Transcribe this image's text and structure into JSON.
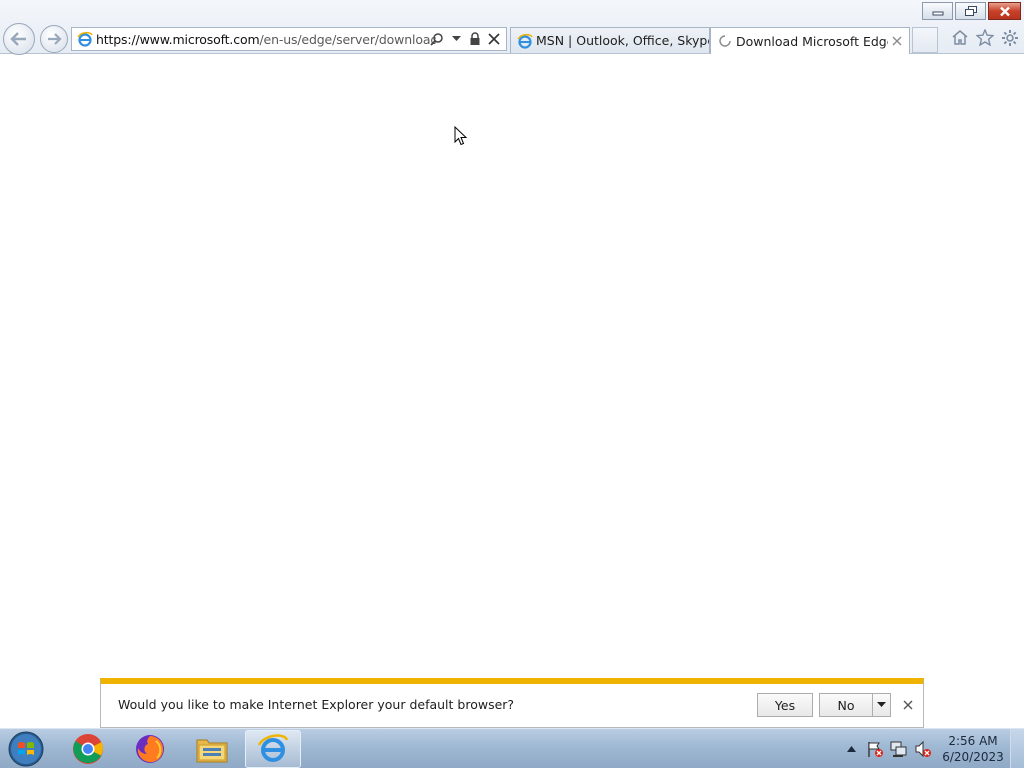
{
  "browser": {
    "address_bar": {
      "url_host_part": "https://www.microsoft.com",
      "url_path_part": "/en-us/edge/server/download?form"
    },
    "tabs": [
      {
        "label": "MSN | Outlook, Office, Skype, ...",
        "active": false,
        "icon": "ie-icon"
      },
      {
        "label": "Download Microsoft Edge",
        "active": true,
        "icon": "loading-icon"
      }
    ]
  },
  "notification": {
    "message": "Would you like to make Internet Explorer your default browser?",
    "yes_label": "Yes",
    "no_label": "No"
  },
  "taskbar": {
    "apps": [
      "chrome-icon",
      "firefox-icon",
      "file-explorer-icon",
      "internet-explorer-icon"
    ],
    "clock": {
      "time": "2:56 AM",
      "date": "6/20/2023"
    }
  },
  "colors": {
    "notification_accent": "#f0b400",
    "close_button": "#c8412a",
    "taskbar": "#9fb8d3"
  }
}
